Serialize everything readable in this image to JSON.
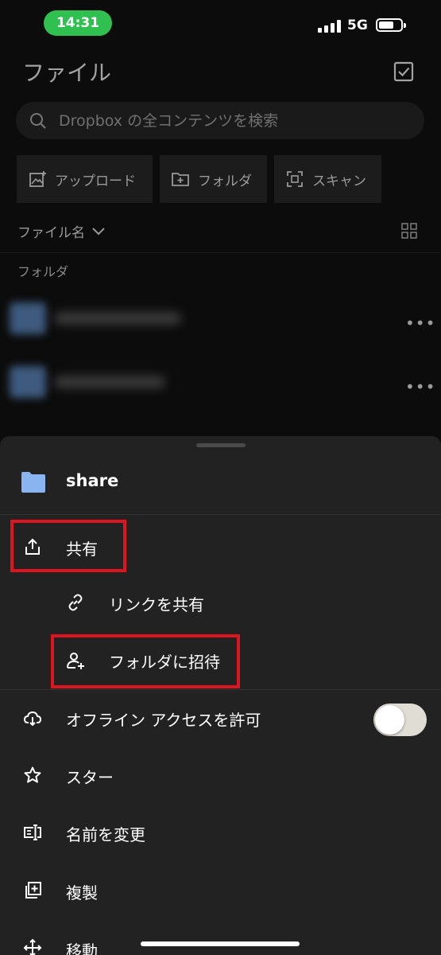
{
  "status_bar": {
    "time": "14:31",
    "network": "5G",
    "time_pill_color": "#30c04f"
  },
  "header": {
    "title": "ファイル",
    "select_icon": "checkbox-icon"
  },
  "search": {
    "placeholder": "Dropbox の全コンテンツを検索",
    "value": ""
  },
  "actions": [
    {
      "label": "アップロード",
      "icon": "upload-image-icon"
    },
    {
      "label": "フォルダ",
      "icon": "new-folder-icon"
    },
    {
      "label": "スキャン",
      "icon": "scan-icon"
    }
  ],
  "sort": {
    "label": "ファイル名",
    "icon": "chevron-down-icon",
    "view_icon": "grid-view-icon"
  },
  "section": {
    "label": "フォルダ"
  },
  "sheet": {
    "folder_name": "share",
    "folder_color": "#8ab4f0",
    "highlight_color": "#e0141e",
    "items": [
      {
        "label": "共有",
        "icon": "share-icon"
      },
      {
        "label": "リンクを共有",
        "icon": "link-icon"
      },
      {
        "label": "フォルダに招待",
        "icon": "add-person-icon"
      },
      {
        "label": "オフライン アクセスを許可",
        "icon": "cloud-download-icon",
        "toggle": false
      },
      {
        "label": "スター",
        "icon": "star-icon"
      },
      {
        "label": "名前を変更",
        "icon": "rename-icon"
      },
      {
        "label": "複製",
        "icon": "duplicate-icon"
      },
      {
        "label": "移動",
        "icon": "move-icon"
      }
    ]
  }
}
